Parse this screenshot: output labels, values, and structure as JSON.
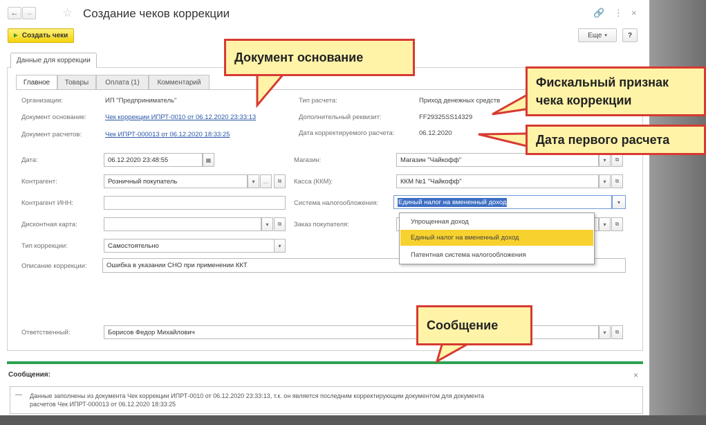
{
  "window": {
    "title": "Создание чеков коррекции",
    "create_checks_label": "Создать чеки",
    "more_label": "Еще",
    "help_label": "?"
  },
  "outer_tab": "Данные для коррекции",
  "tabs": [
    "Главное",
    "Товары",
    "Оплата (1)",
    "Комментарий"
  ],
  "left_fields": {
    "org_label": "Организация:",
    "org_value": "ИП \"Предприниматель\"",
    "basis_doc_label": "Документ основание:",
    "basis_doc_link": "Чек коррекции ИПРТ-0010 от 06.12.2020 23:33:13",
    "calc_doc_label": "Документ расчетов:",
    "calc_doc_link": "Чек ИПРТ-000013 от 06.12.2020 18:33:25",
    "date_label": "Дата:",
    "date_value": "06.12.2020 23:48:55",
    "counterparty_label": "Контрагент:",
    "counterparty_value": "Розничный покупатель",
    "counterparty_inn_label": "Контрагент ИНН:",
    "counterparty_inn_value": "",
    "discount_card_label": "Дисконтная карта:",
    "discount_card_value": "",
    "correction_type_label": "Тип коррекции:",
    "correction_type_value": "Самостоятельно",
    "description_label": "Описание коррекции:",
    "description_value": "Ошибка в указании СНО при применении ККТ",
    "responsible_label": "Ответственный:",
    "responsible_value": "Борисов Федор Михайлович"
  },
  "right_fields": {
    "calc_type_label": "Тип расчета:",
    "calc_type_value": "Приход денежных средств",
    "extra_req_label": "Дополнительный реквизит:",
    "extra_req_value": "FF29325SS14329",
    "corrected_date_label": "Дата корректируемого расчета:",
    "corrected_date_value": "06.12.2020",
    "store_label": "Магазин:",
    "store_value": "Магазин \"Чайкофф\"",
    "cashbox_label": "Касса (ККМ):",
    "cashbox_value": "ККМ №1 \"Чайкофф\"",
    "tax_system_label": "Система налогообложения:",
    "tax_system_value": "Единый налог на вмененный доход",
    "customer_order_label": "Заказ покупателя:"
  },
  "tax_dropdown": {
    "options": [
      "Упрощенная доход",
      "Единый налог на вмененный доход",
      "Патентная система налогообложения"
    ],
    "selected_index": 1
  },
  "callouts": {
    "basis_doc": "Документ основание",
    "fiscal_line1": "Фискальный признак",
    "fiscal_line2": "чека коррекции",
    "first_calc_date": "Дата первого расчета",
    "message": "Сообщение"
  },
  "messages": {
    "header": "Сообщения:",
    "text_line1": "Данные заполнены из документа Чек коррекции ИПРТ-0010 от 06.12.2020 23:33:13, т.к. он является последним корректирующим документом для документа",
    "text_line2": "расчетов Чек ИПРТ-000013 от 06.12.2020 18:33:25"
  },
  "colors": {
    "accent_yellow": "#f4d20e",
    "link_blue": "#2b58a8",
    "callout_border": "#d63a32",
    "callout_fill": "#fff3a8",
    "message_bar_green": "#2da152"
  }
}
